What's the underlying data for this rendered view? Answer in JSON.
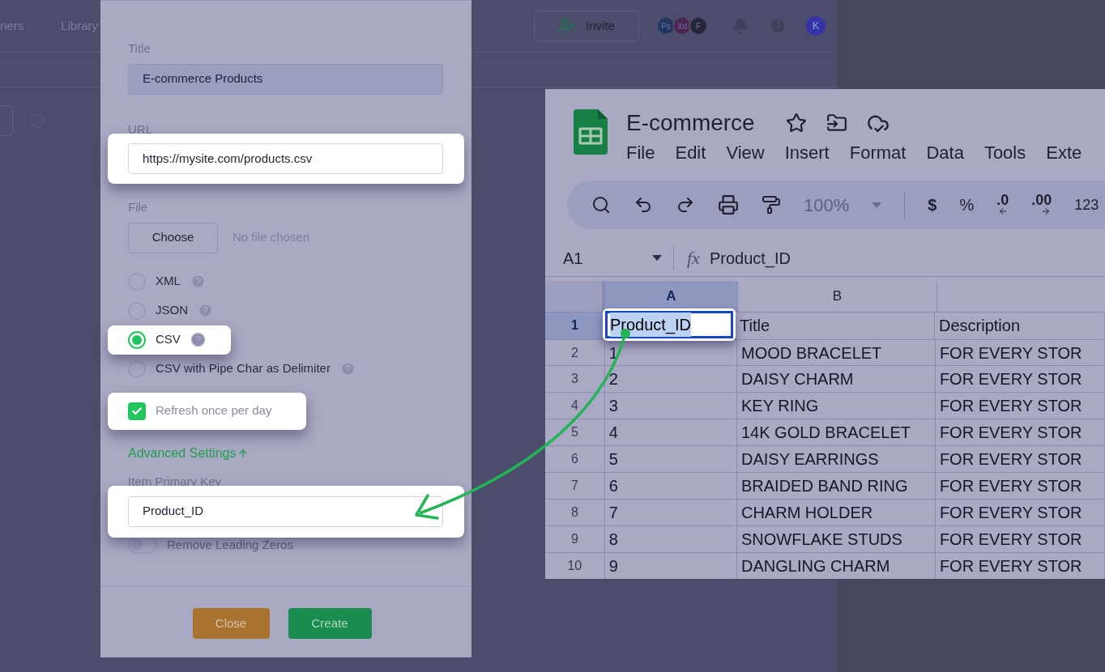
{
  "background": {
    "nav_items": [
      "ners",
      "Library"
    ],
    "invite_button": "Invite",
    "avatars": [
      {
        "label": "Ps",
        "color": "#23365f"
      },
      {
        "label": "Xd",
        "color": "#4b2450"
      },
      {
        "label": "F",
        "color": "#26263a"
      }
    ],
    "user_avatar": "K"
  },
  "modal": {
    "title_label": "Title",
    "title_value": "E-commerce Products",
    "url_label": "URL",
    "url_value": "https://mysite.com/products.csv",
    "url_highlighted": true,
    "file_label": "File",
    "file_button": "Choose",
    "file_status": "No file chosen",
    "formats": [
      {
        "label": "XML",
        "selected": false,
        "highlighted": false
      },
      {
        "label": "JSON",
        "selected": false,
        "highlighted": false
      },
      {
        "label": "CSV",
        "selected": true,
        "highlighted": true
      },
      {
        "label": "CSV with Pipe Char as Delimiter",
        "selected": false,
        "highlighted": false
      }
    ],
    "refresh": {
      "label": "Refresh once per day",
      "checked": true,
      "highlighted": true
    },
    "advanced": "Advanced Settings",
    "primary_key_label": "Item Primary Key",
    "primary_key_value": "Product_ID",
    "primary_key_highlighted": true,
    "remove_zeros": {
      "label": "Remove Leading Zeros",
      "on": false
    },
    "buttons": [
      {
        "label": "Close",
        "kind": "secondary"
      },
      {
        "label": "Create",
        "kind": "primary"
      }
    ]
  },
  "sheet": {
    "title": "E-commerce",
    "menu": [
      "File",
      "Edit",
      "View",
      "Insert",
      "Format",
      "Data",
      "Tools",
      "Exte"
    ],
    "zoom": "100%",
    "toolbar_texts": [
      "$",
      "%",
      ".0",
      ".00",
      "123"
    ],
    "cell_ref": "A1",
    "function_label": "fx",
    "formula": "Product_ID",
    "columns": [
      {
        "label": "A",
        "selected": true
      },
      {
        "label": "B",
        "selected": false
      }
    ],
    "rows": [
      {
        "number": "1",
        "selected": true,
        "cells": [
          "Product_ID",
          "Title",
          "Description"
        ]
      },
      {
        "number": "2",
        "selected": false,
        "cells": [
          "1",
          "MOOD BRACELET",
          "FOR EVERY STOR"
        ]
      },
      {
        "number": "3",
        "selected": false,
        "cells": [
          "2",
          "DAISY CHARM",
          "FOR EVERY STOR"
        ]
      },
      {
        "number": "4",
        "selected": false,
        "cells": [
          "3",
          "KEY RING",
          "FOR EVERY STOR"
        ]
      },
      {
        "number": "5",
        "selected": false,
        "cells": [
          "4",
          "14K GOLD BRACELET",
          "FOR EVERY STOR"
        ]
      },
      {
        "number": "6",
        "selected": false,
        "cells": [
          "5",
          "DAISY EARRINGS",
          "FOR EVERY STOR"
        ]
      },
      {
        "number": "7",
        "selected": false,
        "cells": [
          "6",
          "BRAIDED BAND RING",
          "FOR EVERY STOR"
        ]
      },
      {
        "number": "8",
        "selected": false,
        "cells": [
          "7",
          "CHARM HOLDER",
          "FOR EVERY STOR"
        ]
      },
      {
        "number": "9",
        "selected": false,
        "cells": [
          "8",
          "SNOWFLAKE STUDS",
          "FOR EVERY STOR"
        ]
      },
      {
        "number": "10",
        "selected": false,
        "cells": [
          "9",
          "DANGLING CHARM",
          "FOR EVERY STOR"
        ]
      }
    ]
  }
}
